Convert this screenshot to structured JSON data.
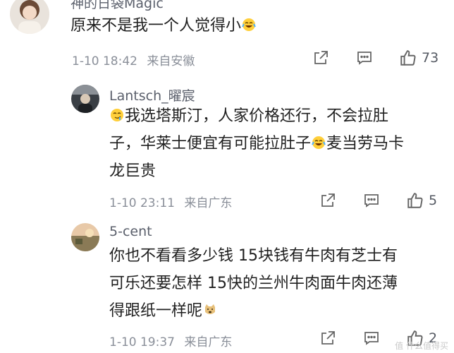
{
  "comments": [
    {
      "username": "神的日袋Magic",
      "lines": [
        "原来不是我一个人觉得小"
      ],
      "time": "1-10 18:42",
      "location": "来自安徽",
      "likes": "73"
    },
    {
      "username": "Lantsch_曜宸",
      "lines": [
        "我选塔斯汀，人家价格还行，不会拉肚",
        "子，华莱士便宜有可能拉肚子",
        "麦当劳马卡",
        "龙巨贵"
      ],
      "time": "1-10 23:11",
      "location": "来自广东",
      "likes": "5"
    },
    {
      "username": "5-cent",
      "lines": [
        "你也不看看多少钱 15块钱有牛肉有芝士有",
        "可乐还要怎样 15快的兰州牛肉面牛肉还薄",
        "得跟纸一样呢"
      ],
      "time": "1-10 19:37",
      "location": "来自广东",
      "likes": "2"
    }
  ],
  "icons": {
    "share": "share-icon",
    "comment": "comment-icon",
    "like": "thumb-up-icon"
  },
  "watermark": "值 什么值得买"
}
